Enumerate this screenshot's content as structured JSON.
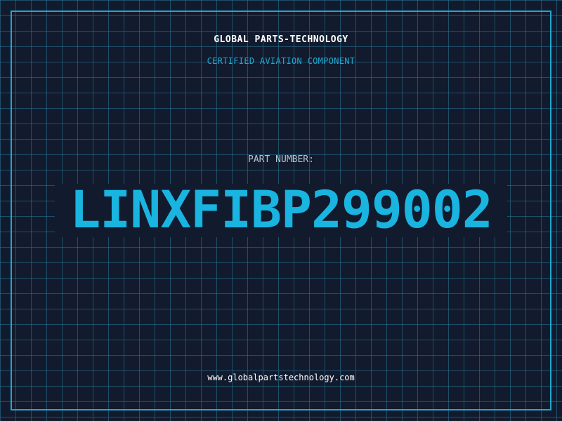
{
  "header": {
    "company_name": "GLOBAL PARTS-TECHNOLOGY",
    "subtitle": "CERTIFIED AVIATION COMPONENT"
  },
  "part": {
    "label": "PART NUMBER:",
    "number": "LINXFIBP299002"
  },
  "footer": {
    "website": "www.globalpartstechnology.com"
  },
  "colors": {
    "background": "#121b2e",
    "grid": "#28788f",
    "frame": "#1fa8d0",
    "accent": "#19b4e0",
    "label": "#b7c3d1",
    "text": "#ffffff"
  }
}
